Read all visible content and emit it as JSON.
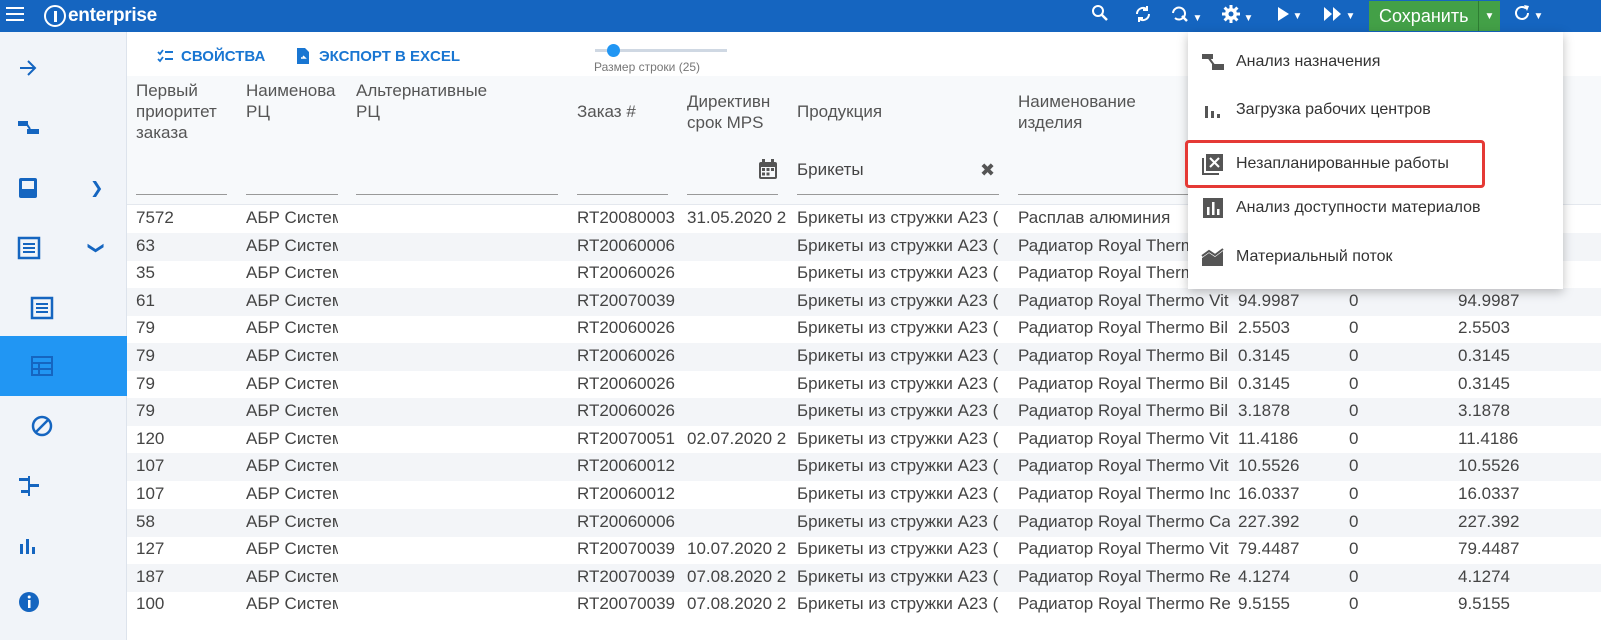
{
  "app": {
    "logo_text": "enterprise"
  },
  "topbar": {
    "save_label": "Сохранить",
    "icons": [
      "menu-icon",
      "search-icon",
      "sync-icon",
      "refresh-search-icon",
      "gear-icon",
      "play-icon",
      "fast-forward-icon",
      "refresh-icon"
    ]
  },
  "toolbar": {
    "properties_label": "СВОЙСТВА",
    "export_label": "ЭКСПОРТ В EXCEL",
    "row_size_label": "Размер строки (25)"
  },
  "columns": [
    {
      "title": "Первый\nприоритет\nзаказа"
    },
    {
      "title": "Наименова\nРЦ"
    },
    {
      "title": "Альтернативные\nРЦ"
    },
    {
      "title": "Заказ #"
    },
    {
      "title": "Директивн\nсрок MPS"
    },
    {
      "title": "Продукция"
    },
    {
      "title": "Наименование\nизделия"
    }
  ],
  "filters": {
    "product": "Брикеты"
  },
  "rows": [
    [
      "7572",
      "АБР Система",
      "",
      "RT20080003",
      "31.05.2020 2",
      "Брикеты из стружки А23 (",
      "Расплав алюминия",
      "",
      "",
      ""
    ],
    [
      "63",
      "АБР Система",
      "",
      "RT20060006",
      "",
      "Брикеты из стружки А23 (",
      "Радиатор Royal Thermo",
      "",
      "",
      ""
    ],
    [
      "35",
      "АБР Система",
      "",
      "RT20060026",
      "",
      "Брикеты из стружки А23 (",
      "Радиатор Royal Therm",
      "",
      "",
      ""
    ],
    [
      "61",
      "АБР Система",
      "",
      "RT20070039",
      "",
      "Брикеты из стружки А23 (",
      "Радиатор Royal Thermo Vit",
      "94.9987",
      "0",
      "94.9987"
    ],
    [
      "79",
      "АБР Система",
      "",
      "RT20060026",
      "",
      "Брикеты из стружки А23 (",
      "Радиатор Royal Thermo Bil",
      "2.5503",
      "0",
      "2.5503"
    ],
    [
      "79",
      "АБР Система",
      "",
      "RT20060026",
      "",
      "Брикеты из стружки А23 (",
      "Радиатор Royal Thermo Bil",
      "0.3145",
      "0",
      "0.3145"
    ],
    [
      "79",
      "АБР Система",
      "",
      "RT20060026",
      "",
      "Брикеты из стружки А23 (",
      "Радиатор Royal Thermo Bil",
      "0.3145",
      "0",
      "0.3145"
    ],
    [
      "79",
      "АБР Система",
      "",
      "RT20060026",
      "",
      "Брикеты из стружки А23 (",
      "Радиатор Royal Thermo Bil",
      "3.1878",
      "0",
      "3.1878"
    ],
    [
      "120",
      "АБР Система",
      "",
      "RT20070051",
      "02.07.2020 2",
      "Брикеты из стружки А23 (",
      "Радиатор Royal Thermo Vit",
      "11.4186",
      "0",
      "11.4186"
    ],
    [
      "107",
      "АБР Система",
      "",
      "RT20060012",
      "",
      "Брикеты из стружки А23 (",
      "Радиатор Royal Thermo Vit",
      "10.5526",
      "0",
      "10.5526"
    ],
    [
      "107",
      "АБР Система",
      "",
      "RT20060012",
      "",
      "Брикеты из стружки А23 (",
      "Радиатор Royal Thermo Ind",
      "16.0337",
      "0",
      "16.0337"
    ],
    [
      "58",
      "АБР Система",
      "",
      "RT20060006",
      "",
      "Брикеты из стружки А23 (",
      "Радиатор Royal Thermo Ca",
      "227.392",
      "0",
      "227.392"
    ],
    [
      "127",
      "АБР Система",
      "",
      "RT20070039",
      "10.07.2020 2",
      "Брикеты из стружки А23 (",
      "Радиатор Royal Thermo Vit",
      "79.4487",
      "0",
      "79.4487"
    ],
    [
      "187",
      "АБР Система",
      "",
      "RT20070039",
      "07.08.2020 2",
      "Брикеты из стружки А23 (",
      "Радиатор Royal Thermo Re",
      "4.1274",
      "0",
      "4.1274"
    ],
    [
      "100",
      "АБР Система",
      "",
      "RT20070039",
      "07.08.2020 2",
      "Брикеты из стружки А23 (",
      "Радиатор Royal Thermo Re",
      "9.5155",
      "0",
      "9.5155"
    ]
  ],
  "menu": {
    "items": [
      {
        "label": "Анализ назначения",
        "icon": "assignment-analysis-icon"
      },
      {
        "label": "Загрузка рабочих центров",
        "icon": "bar-chart-icon"
      },
      {
        "label": "Незапланированные работы",
        "icon": "unscheduled-icon"
      },
      {
        "label": "Анализ доступности материалов",
        "icon": "chart-box-icon"
      },
      {
        "label": "Материальный поток",
        "icon": "area-chart-icon"
      }
    ]
  },
  "colors": {
    "accent": "#1565c0",
    "save": "#43a047",
    "active": "#2196f3",
    "highlight_border": "#e53935"
  }
}
